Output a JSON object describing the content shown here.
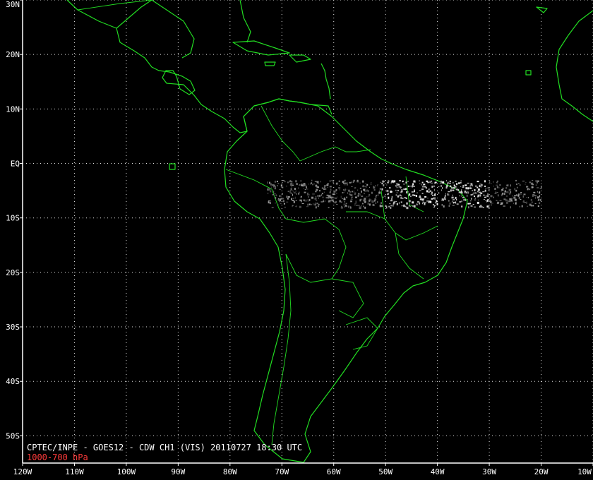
{
  "map": {
    "title": "CPTEC/INPE - GOES12 - CDW CH1 (VIS) 20110727 18:30 UTC",
    "level": "1000-700 hPa",
    "lat_labels": [
      "30N",
      "20N",
      "10N",
      "EQ",
      "10S",
      "20S",
      "30S",
      "40S",
      "50S"
    ],
    "lon_labels": [
      "120W",
      "110W",
      "100W",
      "90W",
      "80W",
      "70W",
      "60W",
      "50W",
      "40W",
      "30W",
      "20W",
      "10W"
    ],
    "lat_range": [
      -55,
      30
    ],
    "lon_range": [
      -120,
      -10
    ],
    "coastline_color": "#22dd22",
    "grid_color": "#e0e0e0",
    "level_color": "#ff3b3b",
    "wind_vector_band": {
      "lat_range": [
        -8,
        -3
      ],
      "lon_range": [
        -73,
        -20
      ]
    }
  }
}
